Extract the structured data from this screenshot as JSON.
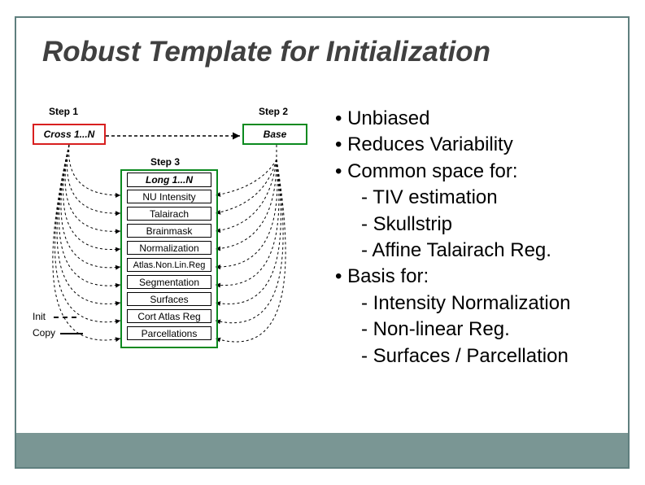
{
  "title": "Robust Template for Initialization",
  "bullets": {
    "b1": "Unbiased",
    "b2": "Reduces Variability",
    "b3": "Common space for:",
    "b3a": "TIV estimation",
    "b3b": "Skullstrip",
    "b3c": "Affine Talairach Reg.",
    "b4": "Basis for:",
    "b4a": "Intensity Normalization",
    "b4b": "Non-linear Reg.",
    "b4c": "Surfaces / Parcellation"
  },
  "diagram": {
    "step1_label": "Step 1",
    "step2_label": "Step 2",
    "step3_label": "Step 3",
    "cross": "Cross 1...N",
    "base": "Base",
    "long": "Long 1...N",
    "stages": {
      "s1": "NU Intensity",
      "s2": "Talairach",
      "s3": "Brainmask",
      "s4": "Normalization",
      "s5": "Atlas.Non.Lin.Reg",
      "s6": "Segmentation",
      "s7": "Surfaces",
      "s8": "Cort Atlas Reg",
      "s9": "Parcellations"
    },
    "legend_init": "Init",
    "legend_copy": "Copy"
  }
}
